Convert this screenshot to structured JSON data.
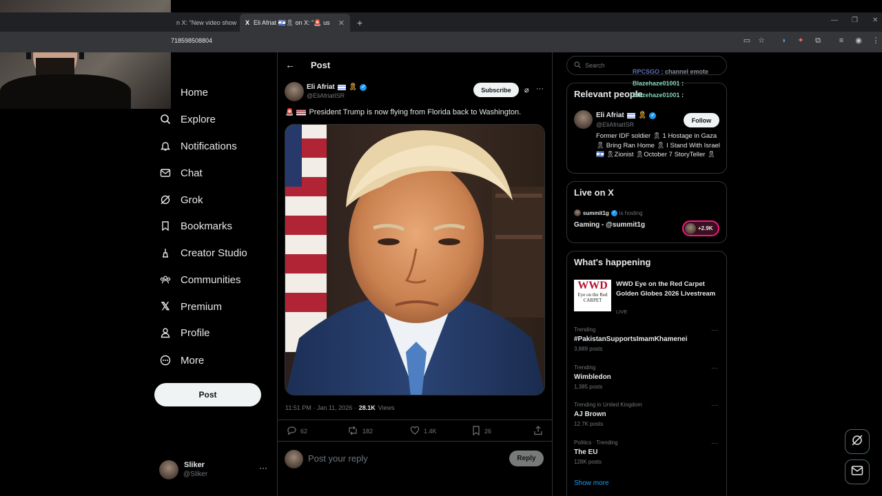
{
  "browser": {
    "tabs": [
      {
        "title": "n X: \"New video show"
      },
      {
        "title": "Eli Afriat 🇮🇱🎗 on X: \"🚨 us Presi"
      }
    ],
    "url": "718598508804"
  },
  "nav": {
    "items": [
      {
        "label": "Home",
        "icon": "home-icon"
      },
      {
        "label": "Explore",
        "icon": "search-icon"
      },
      {
        "label": "Notifications",
        "icon": "bell-icon"
      },
      {
        "label": "Chat",
        "icon": "mail-icon"
      },
      {
        "label": "Grok",
        "icon": "grok-icon"
      },
      {
        "label": "Bookmarks",
        "icon": "bookmark-icon"
      },
      {
        "label": "Creator Studio",
        "icon": "creator-studio-icon"
      },
      {
        "label": "Communities",
        "icon": "communities-icon"
      },
      {
        "label": "Premium",
        "icon": "x-logo-icon"
      },
      {
        "label": "Profile",
        "icon": "person-icon"
      },
      {
        "label": "More",
        "icon": "more-circle-icon"
      }
    ],
    "post_label": "Post",
    "account": {
      "name": "Sliker",
      "handle": "@Sliker"
    }
  },
  "post": {
    "header_title": "Post",
    "author_name": "Eli Afriat",
    "author_handle": "@EliAfriatISR",
    "subscribe_label": "Subscribe",
    "text": "President Trump is now flying from Florida back to Washington.",
    "time": "11:51 PM · Jan 11, 2026 ·",
    "views_count": "28.1K",
    "views_label": "Views",
    "replies": "62",
    "reposts": "182",
    "likes": "1.4K",
    "bookmarks": "26",
    "reply_placeholder": "Post your reply",
    "reply_button": "Reply"
  },
  "sidebar": {
    "search_placeholder": "Search",
    "relevant_title": "Relevant people",
    "relevant_person": {
      "name": "Eli Afriat",
      "handle": "@EliAfriatISR",
      "follow_label": "Follow",
      "bio": "Former IDF soldier 🎗 1 Hostage in Gaza 🎗 Bring Ran Home 🎗 I Stand With Israel 🇮🇱 🎗Zionist 🎗October 7 StoryTeller 🎗"
    },
    "live_title": "Live on X",
    "live": {
      "host": "summit1g",
      "hosting_label": "is hosting",
      "title": "Gaming - @summit1g",
      "count": "+2.9K"
    },
    "happening_title": "What's happening",
    "featured": {
      "title": "WWD Eye on the Red Carpet Golden Globes 2026 Livestream",
      "status": "LIVE",
      "logo_text": "WWD",
      "logo_sub": "Eye on the Red CARPET"
    },
    "trends": [
      {
        "context": "Trending",
        "title": "#PakistanSupportsImamKhamenei",
        "count": "3,889 posts"
      },
      {
        "context": "Trending",
        "title": "Wimbledon",
        "count": "1,385 posts"
      },
      {
        "context": "Trending in United Kingdom",
        "title": "AJ Brown",
        "count": "12.7K posts"
      },
      {
        "context": "Politics · Trending",
        "title": "The EU",
        "count": "128K posts"
      }
    ],
    "show_more": "Show more"
  },
  "chat_overlay": [
    {
      "user": "RPCSGO",
      "text": ": channel emote"
    },
    {
      "user": "Blazehaze01001",
      "text": ":"
    },
    {
      "user": "Blazehaze01001",
      "text": ":"
    }
  ],
  "colors": {
    "accent": "#1d9bf0",
    "bg": "#000000",
    "border": "#2f3336",
    "live_ring": "#f91880"
  }
}
